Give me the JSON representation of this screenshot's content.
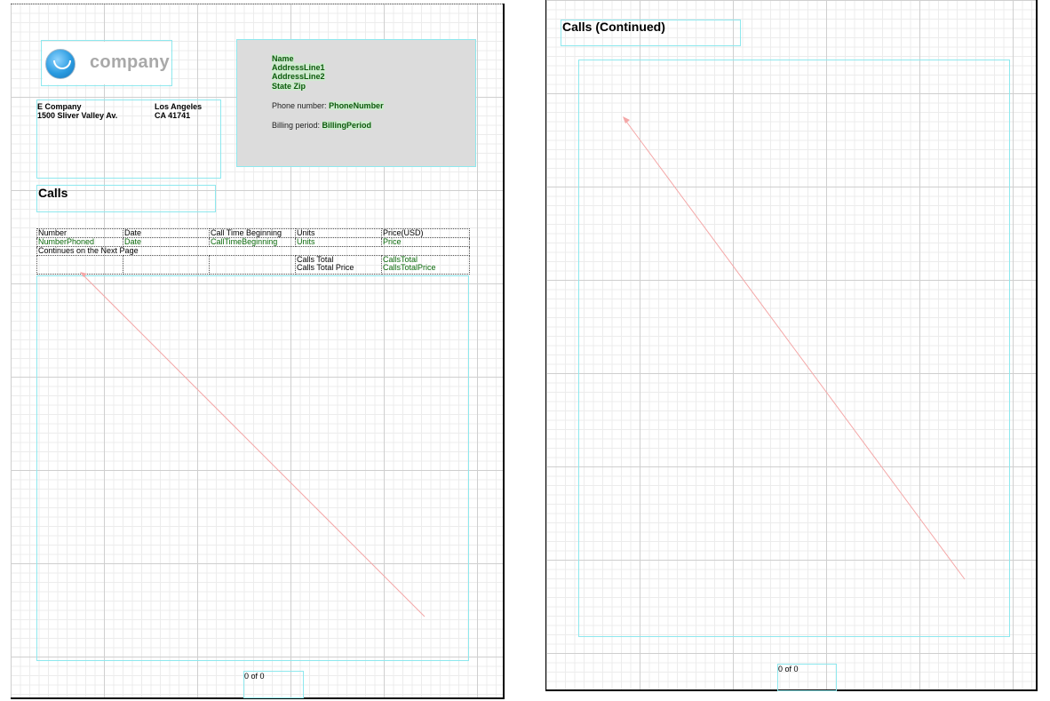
{
  "company": {
    "logo_text": "company",
    "name": "E Company",
    "street": "1500 Sliver Valley Av.",
    "city": "Los Angeles",
    "state_zip": "CA 41741"
  },
  "billing": {
    "name": "Name",
    "address_line1": "AddressLine1",
    "address_line2": "AddressLine2",
    "state_zip": "State Zip",
    "phone_label": "Phone number:",
    "phone_value": "PhoneNumber",
    "period_label": "Billing period:",
    "period_value": "BillingPeriod"
  },
  "calls": {
    "title": "Calls",
    "columns": [
      "Number",
      "Date",
      "Call Time Beginning",
      "Units",
      "Price(USD)"
    ],
    "fields": [
      "NumberPhoned",
      "Date",
      "CallTimeBeginning",
      "Units",
      "Price"
    ],
    "continues_text": "Continues on the Next Page",
    "total_label": "Calls Total",
    "total_value": "CallsTotal",
    "total_price_label": "Calls Total Price",
    "total_price_value": "CallsTotalPrice"
  },
  "page1_footer": "0 of 0",
  "page2": {
    "title": "Calls (Continued)",
    "footer": "0 of 0"
  },
  "colors": {
    "band_outline": "#8ee8ee",
    "field_text": "#0b5a0b",
    "billing_background": "#dcdcdc",
    "flow_arrow": "#f4a7a7"
  }
}
